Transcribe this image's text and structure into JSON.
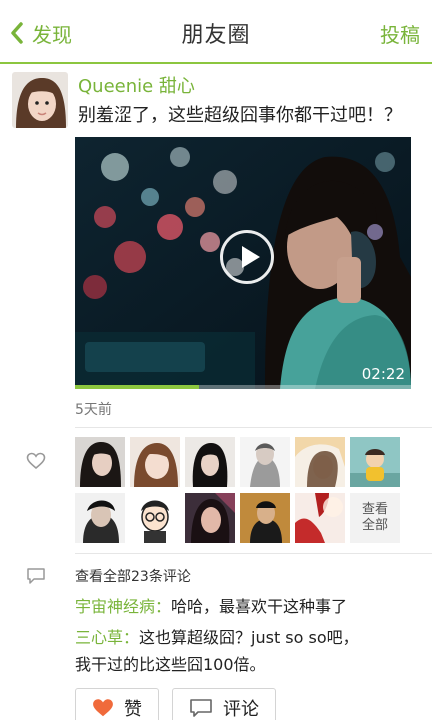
{
  "header": {
    "back_label": "发现",
    "title": "朋友圈",
    "action_label": "投稿"
  },
  "post": {
    "author": "Queenie 甜心",
    "text": "别羞涩了，这些超级囧事你都干过吧！？",
    "video": {
      "duration": "02:22",
      "progress_fraction": 0.37
    },
    "time_ago": "5天前"
  },
  "likes": {
    "more_label_line1": "查看",
    "more_label_line2": "全部",
    "liker_count_shown": 11
  },
  "comments": {
    "view_all_label": "查看全部23条评论",
    "items": [
      {
        "name": "宇宙神经病：",
        "text": "哈哈，最喜欢干这种事了"
      },
      {
        "name": "三心草：",
        "text": "这也算超级囧？just so so吧，",
        "text2": "我干过的比这些囧100倍。"
      }
    ]
  },
  "actions": {
    "like_label": "赞",
    "comment_label": "评论"
  },
  "colors": {
    "accent": "#79b43a",
    "divider": "#8cc63f",
    "heart": "#f06a3b"
  }
}
